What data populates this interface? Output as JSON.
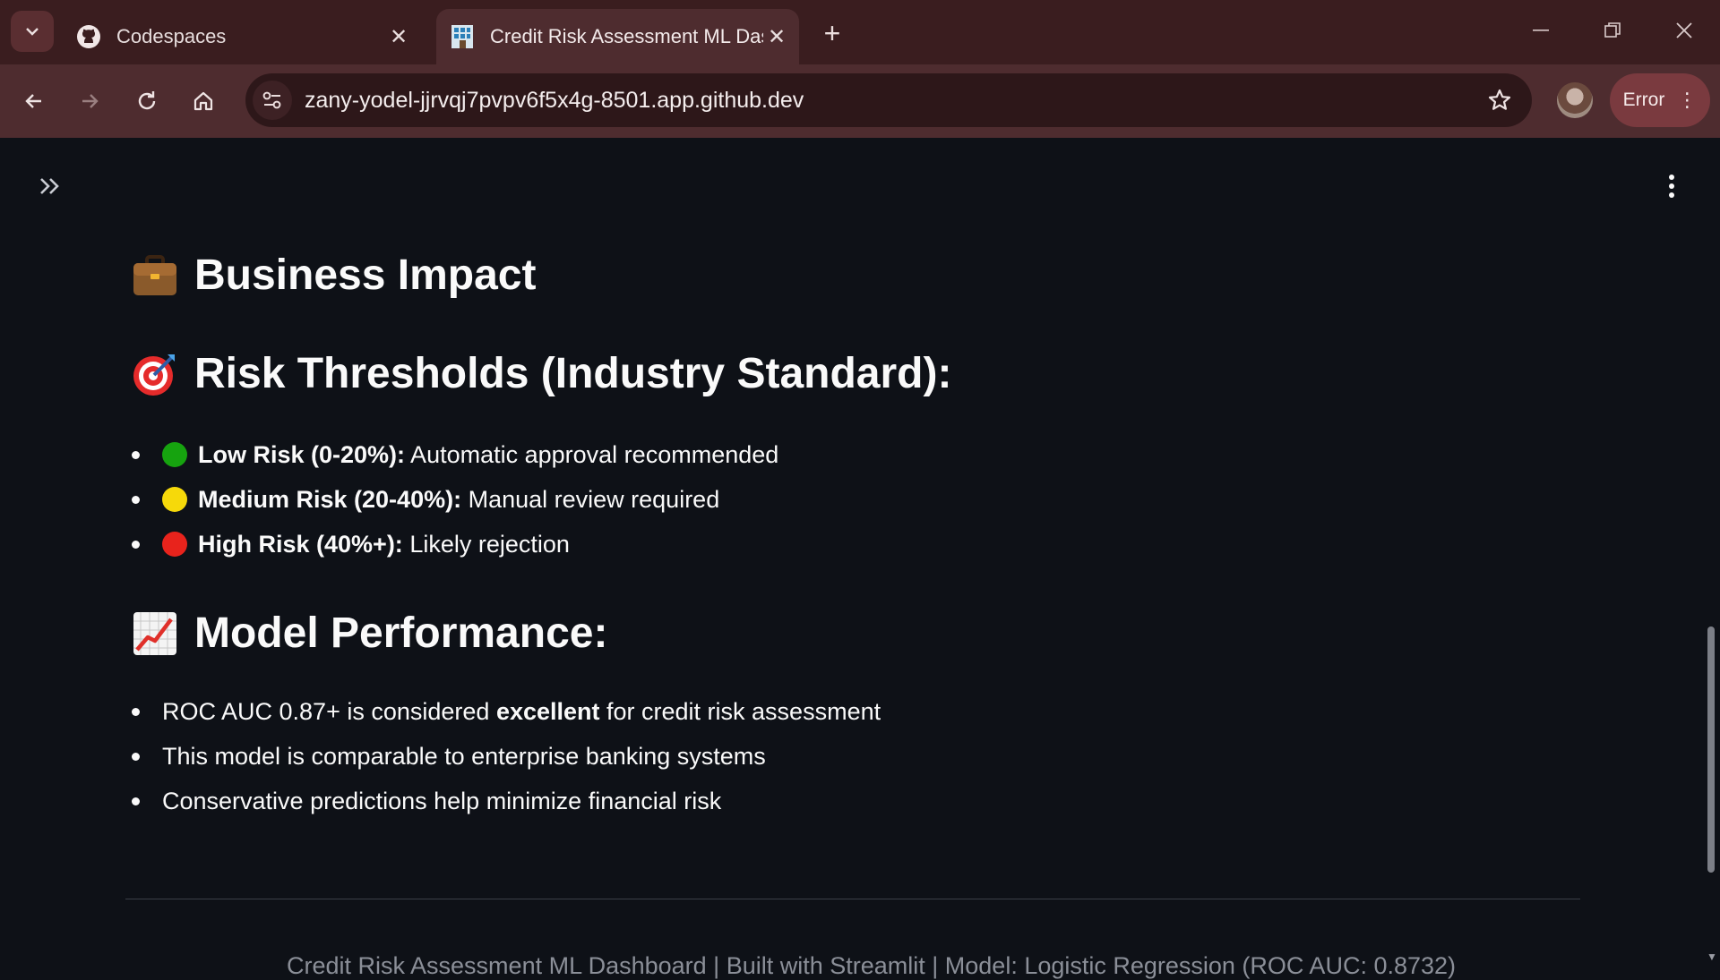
{
  "browser": {
    "tabs": [
      {
        "title": "Codespaces",
        "icon": "github-icon",
        "active": false
      },
      {
        "title": "Credit Risk Assessment ML Dashboard",
        "icon": "streamlit-chart-icon",
        "active": true
      }
    ],
    "url": "zany-yodel-jjrvqj7pvpv6f5x4g-8501.app.github.dev",
    "error_label": "Error"
  },
  "content": {
    "business_impact": {
      "emoji": "briefcase",
      "title": "Business Impact"
    },
    "risk_thresholds": {
      "emoji": "direct-hit",
      "title": "Risk Thresholds (Industry Standard):",
      "items": [
        {
          "color": "#16a30f",
          "label": "Low Risk (0-20%):",
          "text": " Automatic approval recommended"
        },
        {
          "color": "#f6d90a",
          "label": "Medium Risk (20-40%):",
          "text": " Manual review required"
        },
        {
          "color": "#e8231c",
          "label": "High Risk (40%+):",
          "text": " Likely rejection"
        }
      ]
    },
    "model_performance": {
      "emoji": "chart-increasing",
      "title": "Model Performance:",
      "item1_pre": "ROC AUC 0.87+ is considered ",
      "item1_bold": "excellent",
      "item1_post": " for credit risk assessment",
      "item2": "This model is comparable to enterprise banking systems",
      "item3": "Conservative predictions help minimize financial risk"
    },
    "footer": "Credit Risk Assessment ML Dashboard | Built with Streamlit | Model: Logistic Regression (ROC AUC: 0.8732)"
  }
}
